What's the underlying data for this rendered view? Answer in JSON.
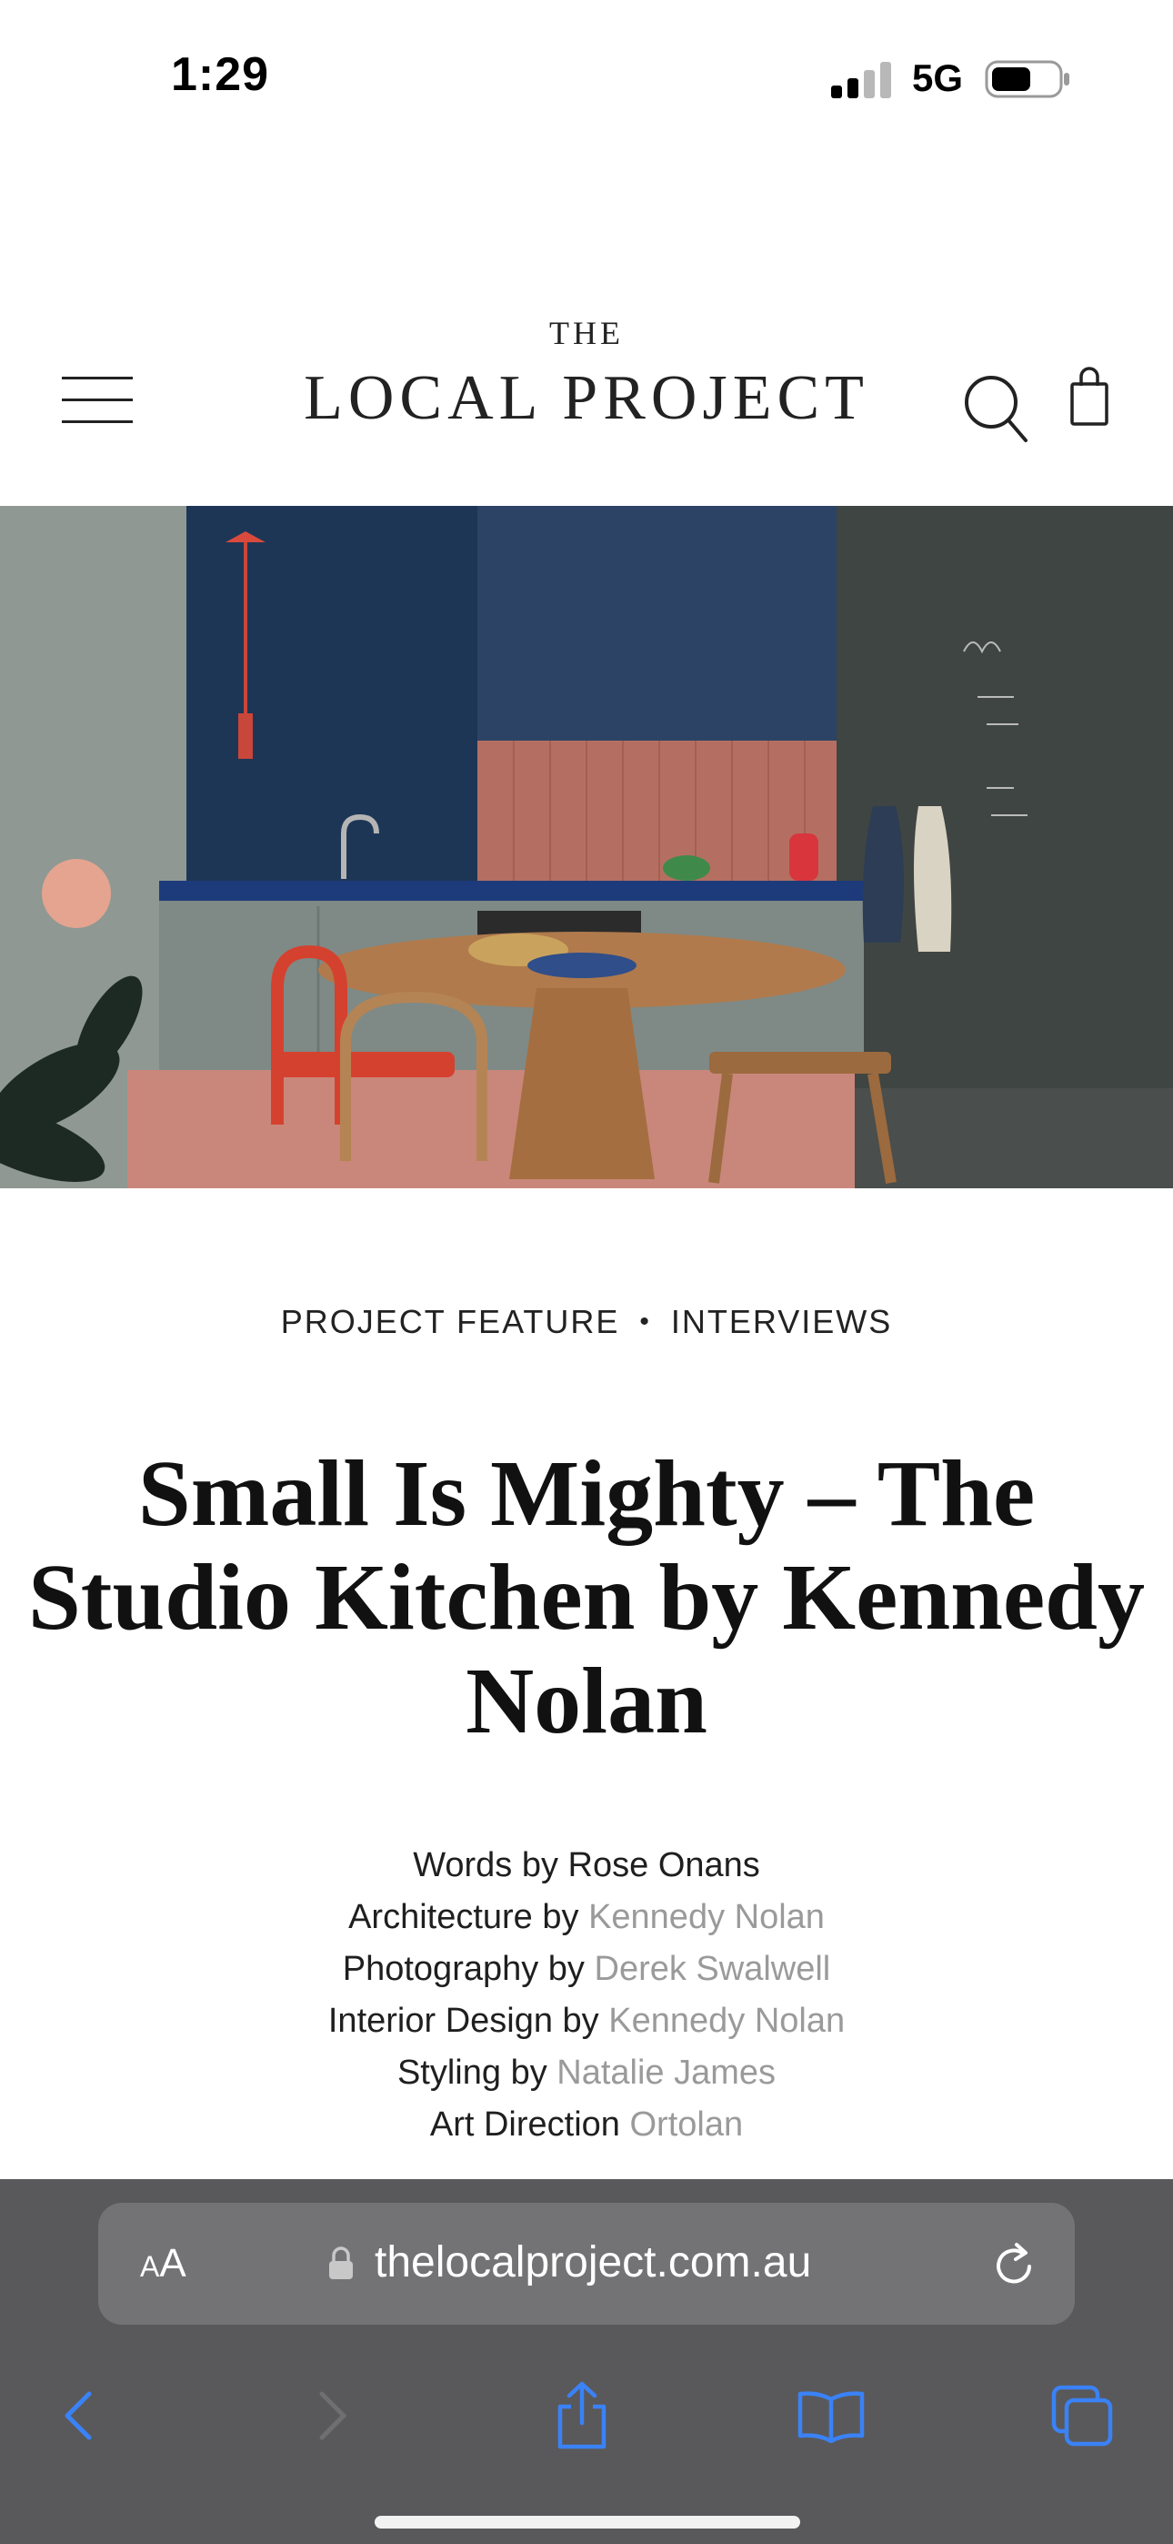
{
  "status_bar": {
    "time": "1:29",
    "network": "5G",
    "signal_bars_active": 2,
    "signal_bars_total": 4,
    "battery_level": 0.55
  },
  "site": {
    "logo_top": "THE",
    "logo_main": "LOCAL PROJECT",
    "icons": [
      "hamburger-menu-icon",
      "search-icon",
      "shopping-bag-icon"
    ]
  },
  "hero": {
    "description_icon": "kitchen-photo"
  },
  "article": {
    "categories": [
      "PROJECT FEATURE",
      "INTERVIEWS"
    ],
    "category_separator": "•",
    "title": "Small Is Mighty – The Studio Kitchen by Kennedy Nolan",
    "credits": [
      {
        "label": "Words by Rose Onans",
        "value": ""
      },
      {
        "label": "Architecture by ",
        "value": "Kennedy Nolan"
      },
      {
        "label": "Photography by ",
        "value": "Derek Swalwell"
      },
      {
        "label": "Interior Design by ",
        "value": "Kennedy Nolan"
      },
      {
        "label": "Styling by ",
        "value": "Natalie James"
      },
      {
        "label": "Art Direction ",
        "value": "Ortolan"
      }
    ]
  },
  "browser": {
    "text_size_label_small": "A",
    "text_size_label_large": "A",
    "url": "thelocalproject.com.au",
    "toolbar": [
      "back-icon",
      "forward-icon",
      "share-icon",
      "bookmarks-icon",
      "tabs-icon"
    ],
    "accent_color": "#3a82f6"
  }
}
